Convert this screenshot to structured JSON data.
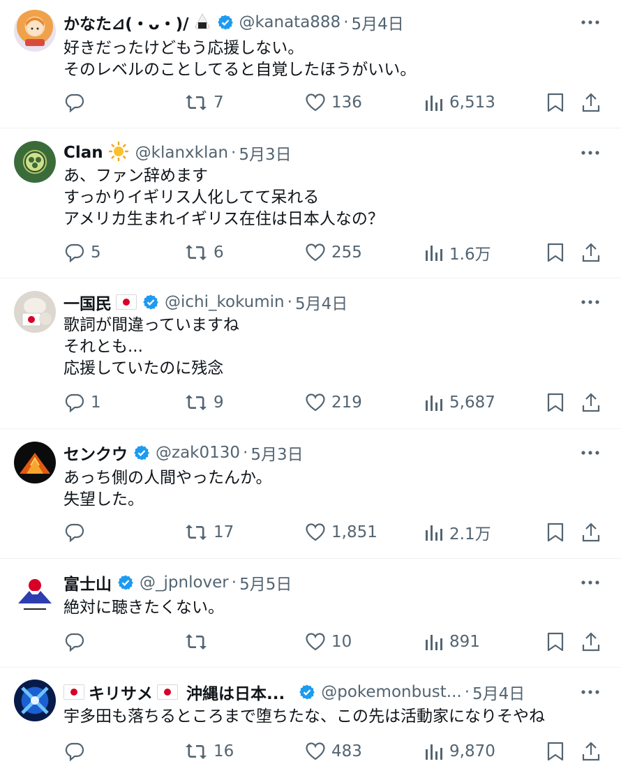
{
  "tweets": [
    {
      "name": "かなた⊿(・ᴗ・)/",
      "handle": "@kanata888",
      "date": "5月4日",
      "verified": true,
      "text": "好きだったけどもう応援しない。\nそのレベルのことしてると自覚したほうがいい。",
      "replies": "",
      "retweets": "7",
      "likes": "136",
      "views": "6,513"
    },
    {
      "name": "Clan",
      "handle": "@klanxklan",
      "date": "5月3日",
      "verified": false,
      "text": "あ、ファン辞めます\nすっかりイギリス人化してて呆れる\nアメリカ生まれイギリス在住は日本人なの？",
      "replies": "5",
      "retweets": "6",
      "likes": "255",
      "views": "1.6万"
    },
    {
      "name": "一国民",
      "handle": "@ichi_kokumin",
      "date": "5月4日",
      "verified": true,
      "text": "歌詞が間違っていますね\nそれとも...\n応援していたのに残念",
      "replies": "1",
      "retweets": "9",
      "likes": "219",
      "views": "5,687"
    },
    {
      "name": "センクウ",
      "handle": "@zak0130",
      "date": "5月3日",
      "verified": true,
      "text": "あっち側の人間やったんか。\n失望した。",
      "replies": "",
      "retweets": "17",
      "likes": "1,851",
      "views": "2.1万"
    },
    {
      "name": "富士山",
      "handle": "@_jpnlover",
      "date": "5月5日",
      "verified": true,
      "text": "絶対に聴きたくない。",
      "replies": "",
      "retweets": "",
      "likes": "10",
      "views": "891"
    },
    {
      "name": "キリサメ",
      "name_suffix": "沖縄は日本...",
      "handle": "@pokemonbust...",
      "date": "5月4日",
      "verified": true,
      "text": "宇多田も落ちるところまで堕ちたな、この先は活動家になりそやね",
      "replies": "",
      "retweets": "16",
      "likes": "483",
      "views": "9,870"
    }
  ],
  "separator": "·",
  "icons": {
    "verified": "verified-badge-icon",
    "more": "more-dots-icon",
    "reply": "reply-bubble-icon",
    "retweet": "retweet-arrows-icon",
    "like": "heart-icon",
    "views": "bar-chart-icon",
    "bookmark": "bookmark-icon",
    "share": "share-upload-icon"
  },
  "colors": {
    "text": "#0f1419",
    "secondary": "#536471",
    "verified": "#1d9bf0",
    "divider": "#eff3f4"
  }
}
